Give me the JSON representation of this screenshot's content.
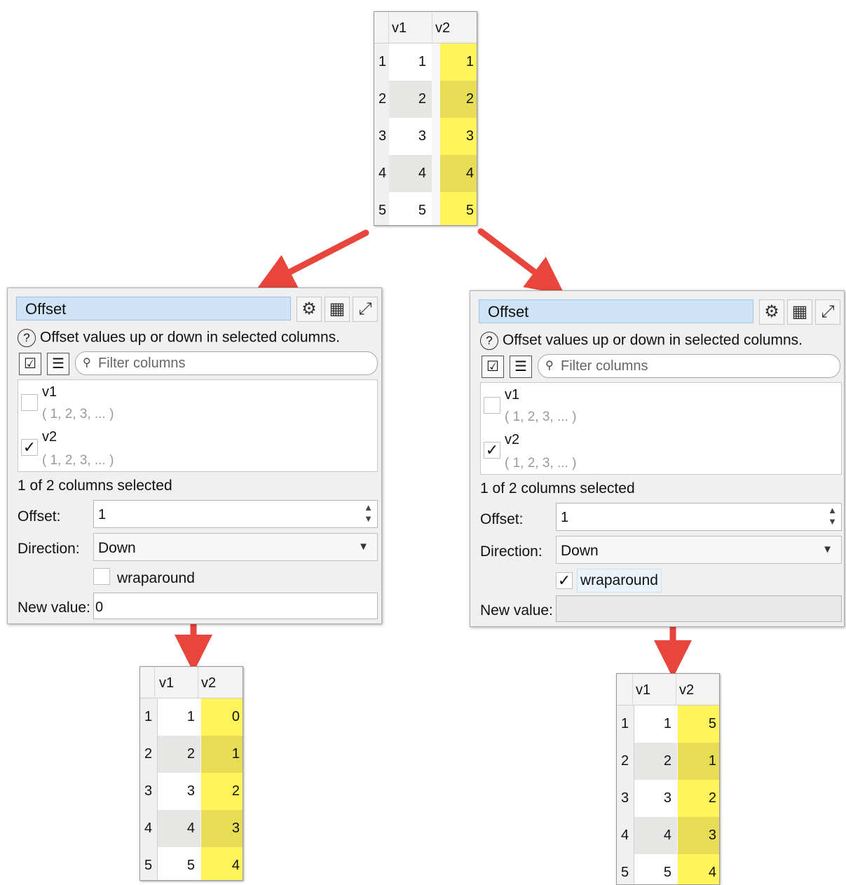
{
  "colors": {
    "arrow": "#e8453c",
    "highlight": "#fff55a",
    "title_bg": "#cfe3f7"
  },
  "input_table": {
    "headers": [
      "v1",
      "v2"
    ],
    "rows": [
      {
        "n": "1",
        "v1": "1",
        "v2": "1"
      },
      {
        "n": "2",
        "v1": "2",
        "v2": "2"
      },
      {
        "n": "3",
        "v1": "3",
        "v2": "3"
      },
      {
        "n": "4",
        "v1": "4",
        "v2": "4"
      },
      {
        "n": "5",
        "v1": "5",
        "v2": "5"
      }
    ]
  },
  "left_panel": {
    "title": "Offset",
    "icons": [
      "gear-icon",
      "table-icon",
      "expand-icon"
    ],
    "description": "Offset values up or down in selected columns.",
    "filter_placeholder": "Filter columns",
    "columns": [
      {
        "name": "v1",
        "values": "( 1, 2, 3, ... )",
        "checked": false
      },
      {
        "name": "v2",
        "values": "( 1, 2, 3, ... )",
        "checked": true
      }
    ],
    "status": "1 of 2 columns selected",
    "offset_label": "Offset:",
    "offset_value": "1",
    "direction_label": "Direction:",
    "direction_value": "Down",
    "wraparound_label": "wraparound",
    "wraparound_checked": false,
    "new_value_label": "New value:",
    "new_value": "0"
  },
  "right_panel": {
    "title": "Offset",
    "icons": [
      "gear-icon",
      "table-icon",
      "expand-icon"
    ],
    "description": "Offset values up or down in selected columns.",
    "filter_placeholder": "Filter columns",
    "columns": [
      {
        "name": "v1",
        "values": "( 1, 2, 3, ... )",
        "checked": false
      },
      {
        "name": "v2",
        "values": "( 1, 2, 3, ... )",
        "checked": true
      }
    ],
    "status": "1 of 2 columns selected",
    "offset_label": "Offset:",
    "offset_value": "1",
    "direction_label": "Direction:",
    "direction_value": "Down",
    "wraparound_label": "wraparound",
    "wraparound_checked": true,
    "new_value_label": "New value:",
    "new_value": ""
  },
  "left_result": {
    "headers": [
      "v1",
      "v2"
    ],
    "rows": [
      {
        "n": "1",
        "v1": "1",
        "v2": "0"
      },
      {
        "n": "2",
        "v1": "2",
        "v2": "1"
      },
      {
        "n": "3",
        "v1": "3",
        "v2": "2"
      },
      {
        "n": "4",
        "v1": "4",
        "v2": "3"
      },
      {
        "n": "5",
        "v1": "5",
        "v2": "4"
      }
    ]
  },
  "right_result": {
    "headers": [
      "v1",
      "v2"
    ],
    "rows": [
      {
        "n": "1",
        "v1": "1",
        "v2": "5"
      },
      {
        "n": "2",
        "v1": "2",
        "v2": "1"
      },
      {
        "n": "3",
        "v1": "3",
        "v2": "2"
      },
      {
        "n": "4",
        "v1": "4",
        "v2": "3"
      },
      {
        "n": "5",
        "v1": "5",
        "v2": "4"
      }
    ]
  },
  "glyphs": {
    "check": "✓",
    "gear": "⚙",
    "table": "▦",
    "expand": "⤢",
    "magnifier": "⚲",
    "question": "?",
    "caret": "▼",
    "spin_up": "▲",
    "spin_down": "▼",
    "list_check": "☑",
    "list": "☰"
  }
}
